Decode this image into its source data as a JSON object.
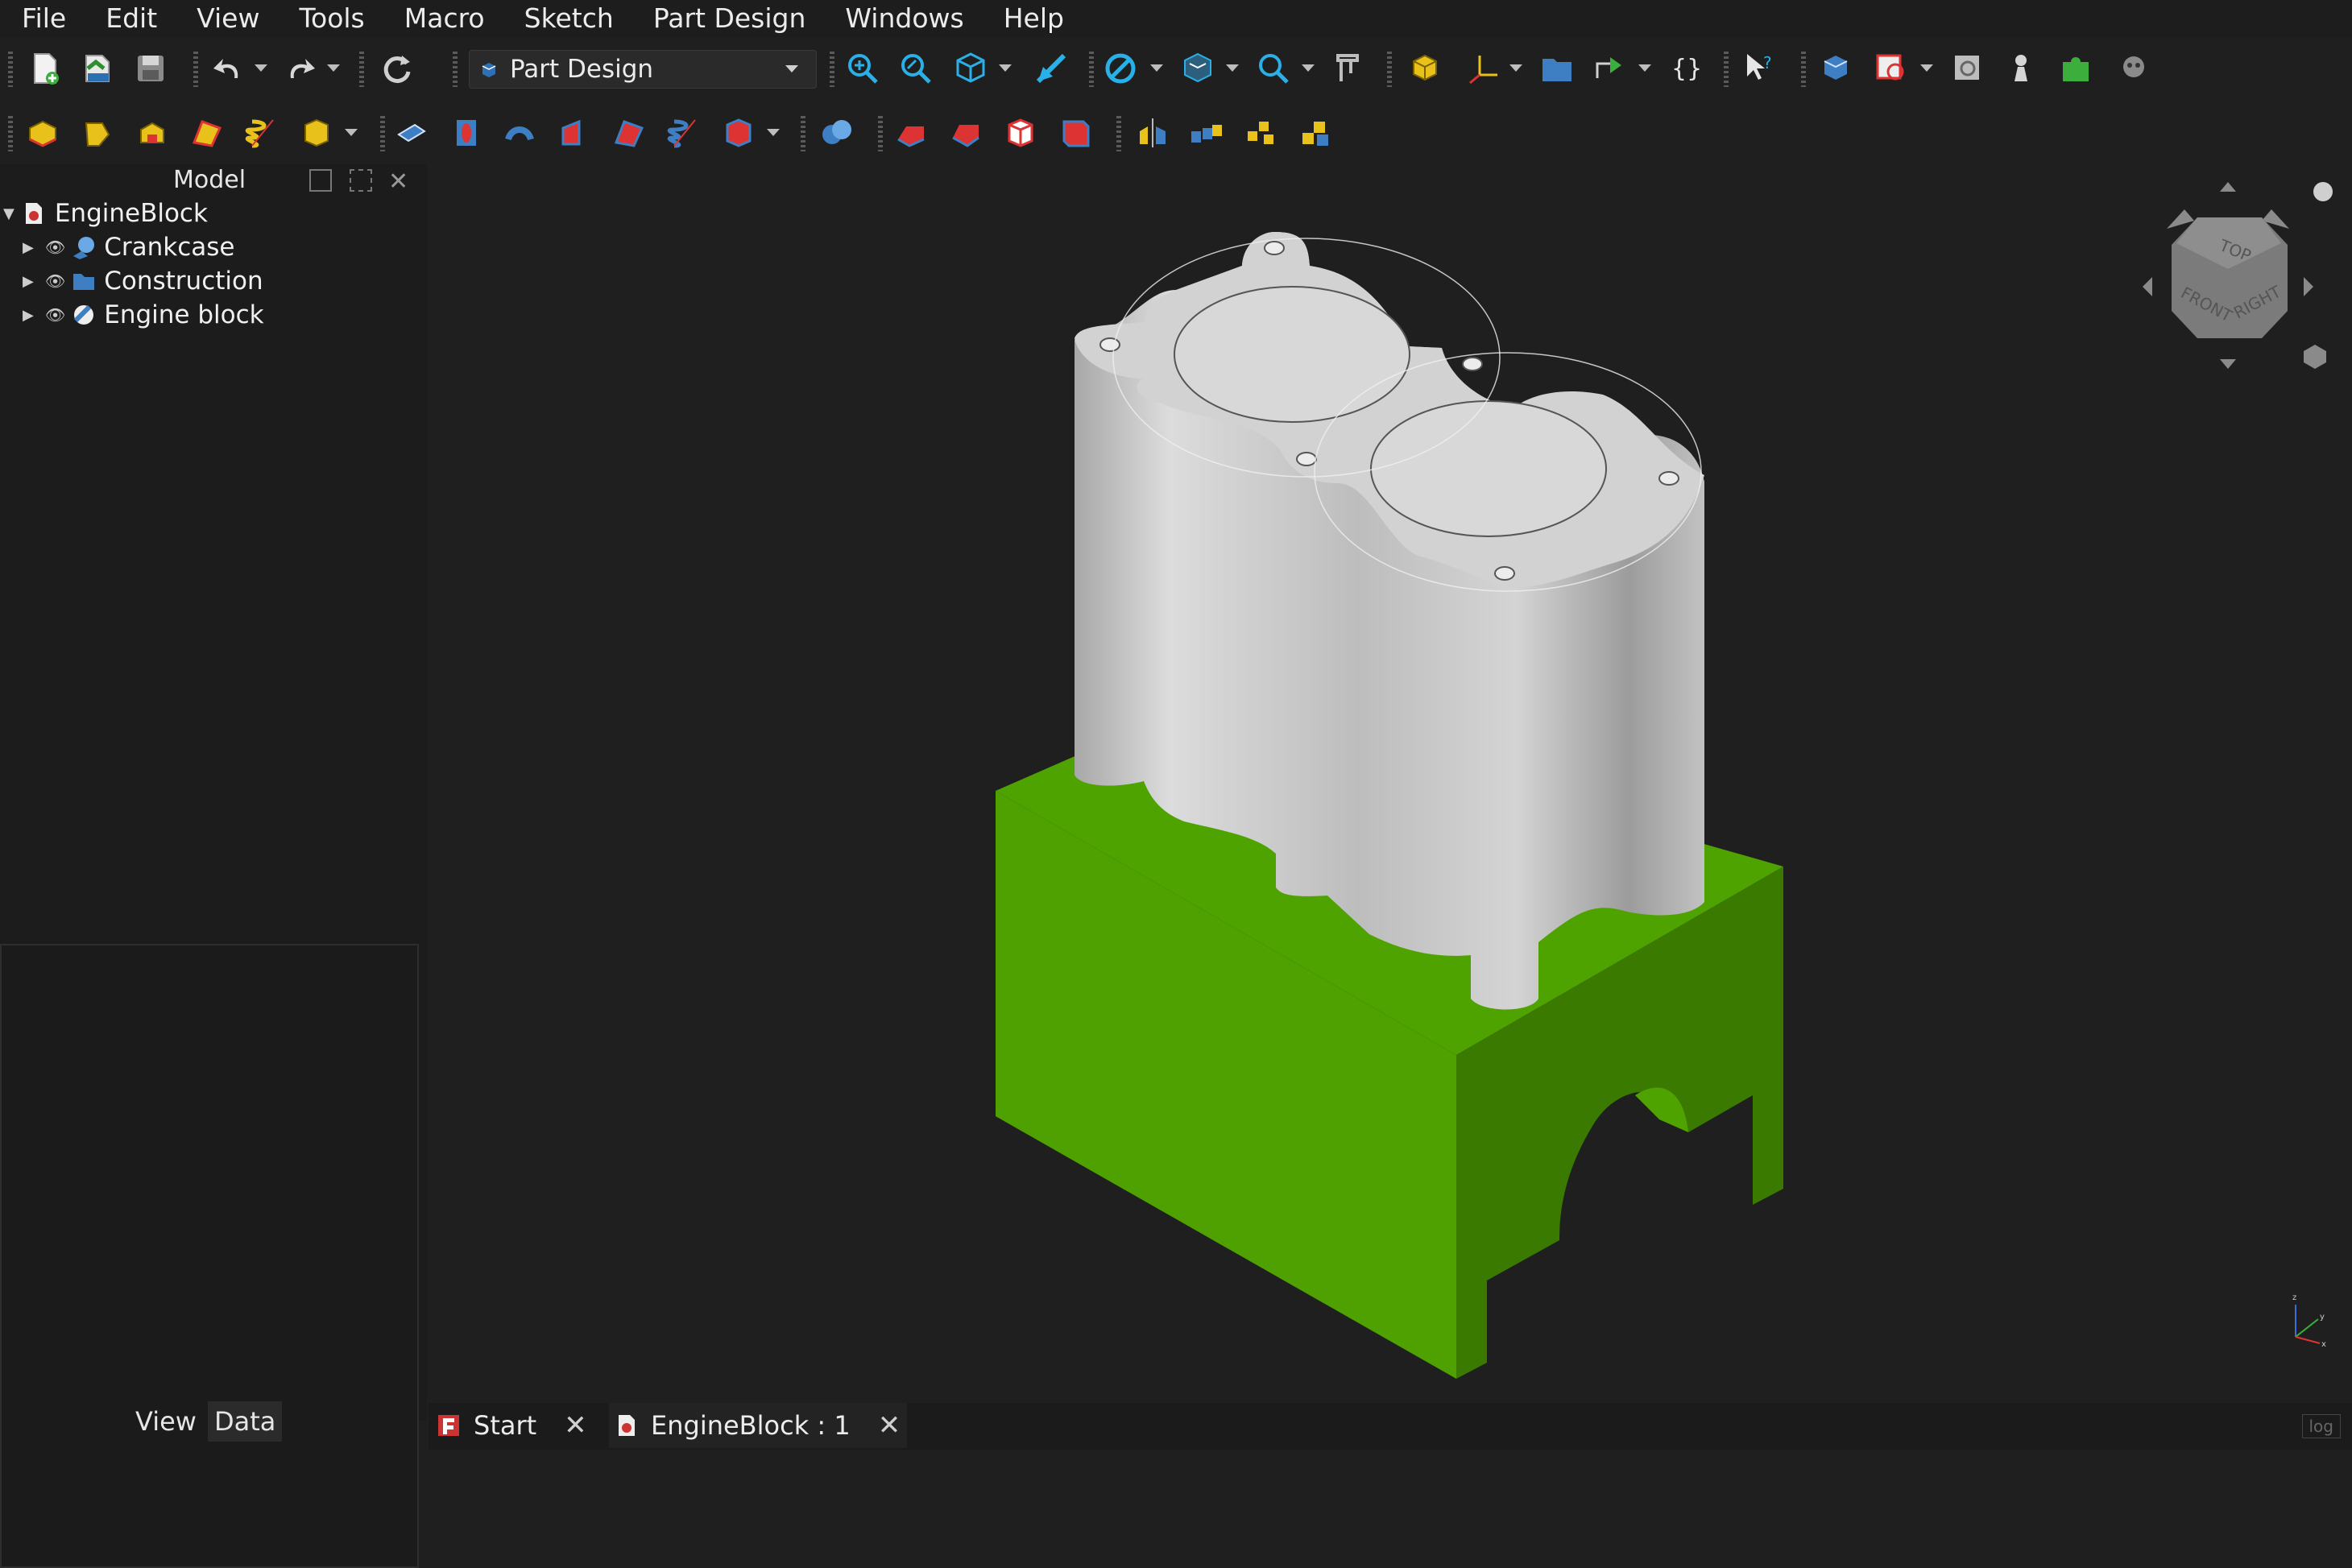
{
  "menu": {
    "items": [
      {
        "label": "File",
        "name": "menu-file"
      },
      {
        "label": "Edit",
        "name": "menu-edit"
      },
      {
        "label": "View",
        "name": "menu-view"
      },
      {
        "label": "Tools",
        "name": "menu-tools"
      },
      {
        "label": "Macro",
        "name": "menu-macro"
      },
      {
        "label": "Sketch",
        "name": "menu-sketch"
      },
      {
        "label": "Part Design",
        "name": "menu-part-design"
      },
      {
        "label": "Windows",
        "name": "menu-windows"
      },
      {
        "label": "Help",
        "name": "menu-help"
      }
    ]
  },
  "toolbar": {
    "workbench": "Part Design"
  },
  "model_panel": {
    "title": "Model",
    "root": "EngineBlock",
    "children": [
      "Crankcase",
      "Construction",
      "Engine block"
    ]
  },
  "property_tabs": {
    "view": "View",
    "data": "Data"
  },
  "document_tabs": {
    "start": "Start",
    "doc": "EngineBlock : 1"
  },
  "navigation_cube": {
    "faces": {
      "top": "TOP",
      "front": "FRONT",
      "right": "RIGHT"
    }
  },
  "status": {
    "log": "log"
  },
  "colors": {
    "accent_green": "#4fa300",
    "ui_bg": "#1f1f1f"
  }
}
